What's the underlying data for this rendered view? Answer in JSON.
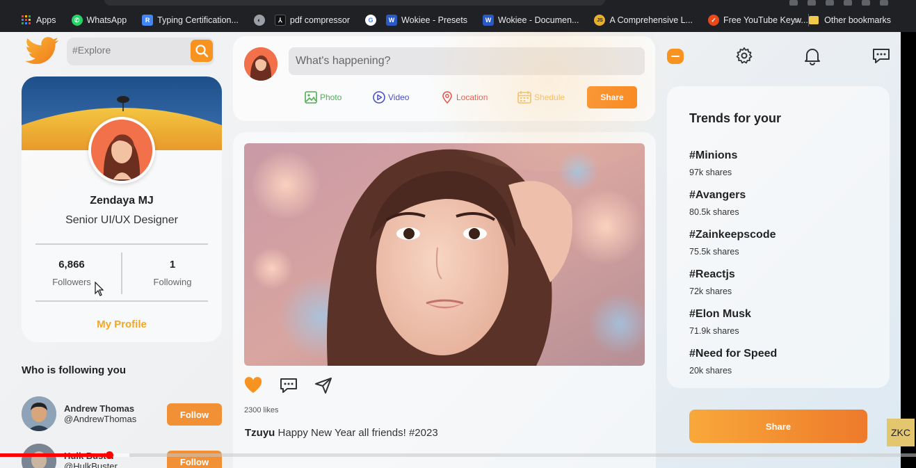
{
  "bookmarks": {
    "items": [
      {
        "label": "Apps",
        "icon": "apps-grid-icon",
        "color": "#ea4335"
      },
      {
        "label": "WhatsApp",
        "icon": "whatsapp-icon",
        "color": "#25d366"
      },
      {
        "label": "Typing Certification...",
        "icon": "typing-icon",
        "color": "#4285f4"
      },
      {
        "label": "",
        "icon": "globe-icon",
        "color": "#9aa0a6"
      },
      {
        "label": "pdf compressor",
        "icon": "pdf-icon",
        "color": "#202124"
      },
      {
        "label": "",
        "icon": "google-icon",
        "color": "#e8eaed"
      },
      {
        "label": "Wokiee - Presets",
        "icon": "wokiee-icon",
        "color": "#2b59c3"
      },
      {
        "label": "Wokiee - Documen...",
        "icon": "wokiee-icon",
        "color": "#2b59c3"
      },
      {
        "label": "A Comprehensive L...",
        "icon": "js-icon",
        "color": "#e8b02a"
      },
      {
        "label": "Free YouTube Keyw...",
        "icon": "keyword-icon",
        "color": "#e8491d"
      }
    ],
    "other": "Other bookmarks"
  },
  "search": {
    "placeholder": "#Explore"
  },
  "profile": {
    "name": "Zendaya MJ",
    "role": "Senior UI/UX Designer",
    "followers_count": "6,866",
    "followers_label": "Followers",
    "following_count": "1",
    "following_label": "Following",
    "link": "My Profile"
  },
  "followers_section": {
    "title": "Who is following you",
    "items": [
      {
        "name": "Andrew Thomas",
        "handle": "@AndrewThomas",
        "button": "Follow"
      },
      {
        "name": "Hulk Buster",
        "handle": "@HulkBuster",
        "button": "Follow"
      }
    ]
  },
  "composer": {
    "placeholder": "What's happening?",
    "options": [
      {
        "label": "Photo",
        "color": "#4caf50"
      },
      {
        "label": "Video",
        "color": "#4a4fc4"
      },
      {
        "label": "Location",
        "color": "#e0524a"
      },
      {
        "label": "Shedule",
        "color": "#f0b94a"
      }
    ],
    "share": "Share"
  },
  "post": {
    "likes": "2300 likes",
    "author": "Tzuyu",
    "text": "Happy New Year all friends! #2023"
  },
  "trends": {
    "title": "Trends for your",
    "items": [
      {
        "tag": "#Minions",
        "count": "97k shares"
      },
      {
        "tag": "#Avangers",
        "count": "80.5k shares"
      },
      {
        "tag": "#Zainkeepscode",
        "count": "75.5k shares"
      },
      {
        "tag": "#Reactjs",
        "count": "72k shares"
      },
      {
        "tag": "#Elon Musk",
        "count": "71.9k shares"
      },
      {
        "tag": "#Need for Speed",
        "count": "20k shares"
      }
    ],
    "share": "Share"
  },
  "colors": {
    "accent": "#f7931e",
    "brand": "#f39a2b"
  },
  "watermark": "ZKC"
}
